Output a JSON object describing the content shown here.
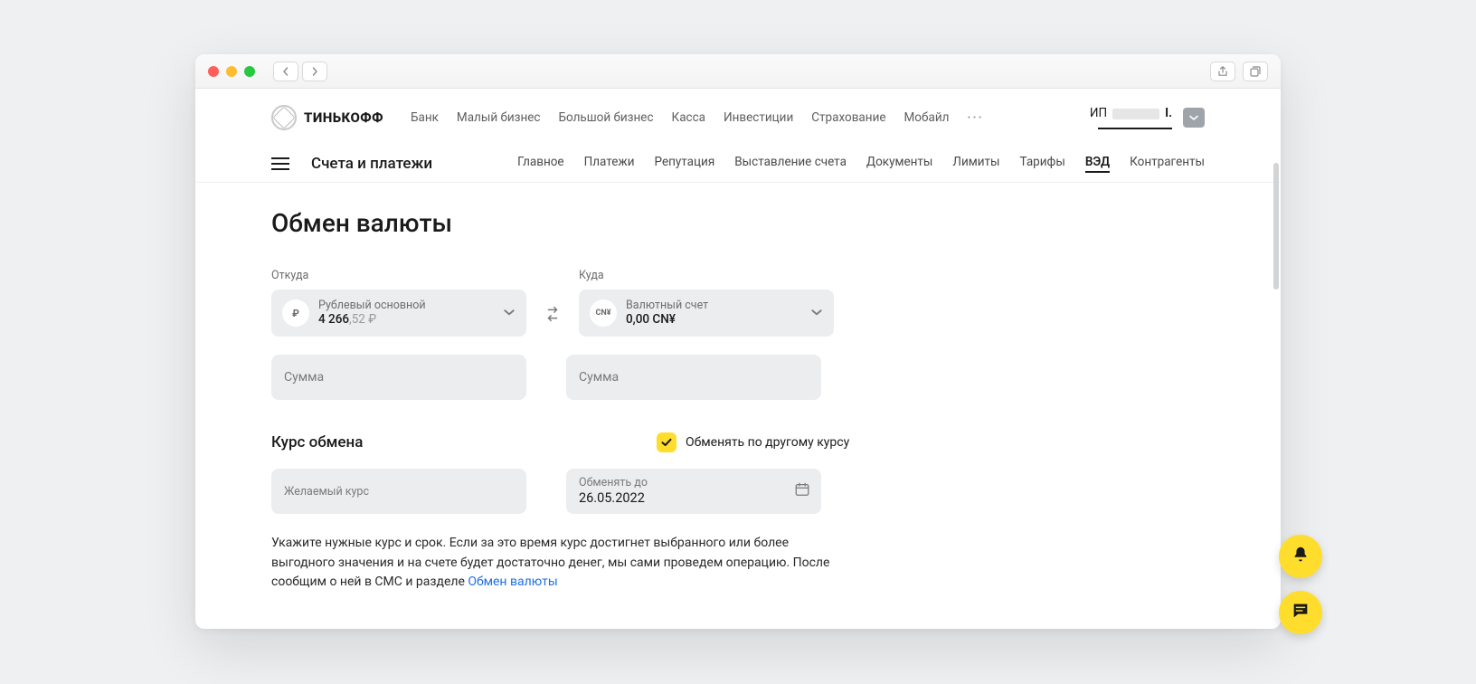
{
  "brand": {
    "name": "ТИНЬКОФФ"
  },
  "global_nav": {
    "items": [
      "Банк",
      "Малый бизнес",
      "Большой бизнес",
      "Касса",
      "Инвестиции",
      "Страхование",
      "Мобайл"
    ],
    "account_prefix": "ИП",
    "account_suffix": "I."
  },
  "section": {
    "title": "Счета и платежи",
    "tabs": [
      "Главное",
      "Платежи",
      "Репутация",
      "Выставление счета",
      "Документы",
      "Лимиты",
      "Тарифы",
      "ВЭД",
      "Контрагенты"
    ],
    "active": "ВЭД"
  },
  "page": {
    "title": "Обмен валюты",
    "from_label": "Откуда",
    "to_label": "Куда",
    "from_account": {
      "name": "Рублевый основной",
      "balance_int": "4 266",
      "balance_frac": ",52 ₽",
      "icon": "₽"
    },
    "to_account": {
      "name": "Валютный счет",
      "balance": "0,00 CN¥",
      "icon": "CN¥"
    },
    "amount_placeholder": "Сумма",
    "rate_title": "Курс обмена",
    "rate_checkbox_label": "Обменять по другому курсу",
    "desired_rate_placeholder": "Желаемый курс",
    "until_label": "Обменять до",
    "until_value": "26.05.2022",
    "help_text_1": "Укажите нужные курс и срок. Если за это время курс достигнет выбранного или более выгодного значения и на счете будет достаточно денег, мы сами проведем операцию. После сообщим о ней в СМС и разделе ",
    "help_link": "Обмен валюты"
  }
}
